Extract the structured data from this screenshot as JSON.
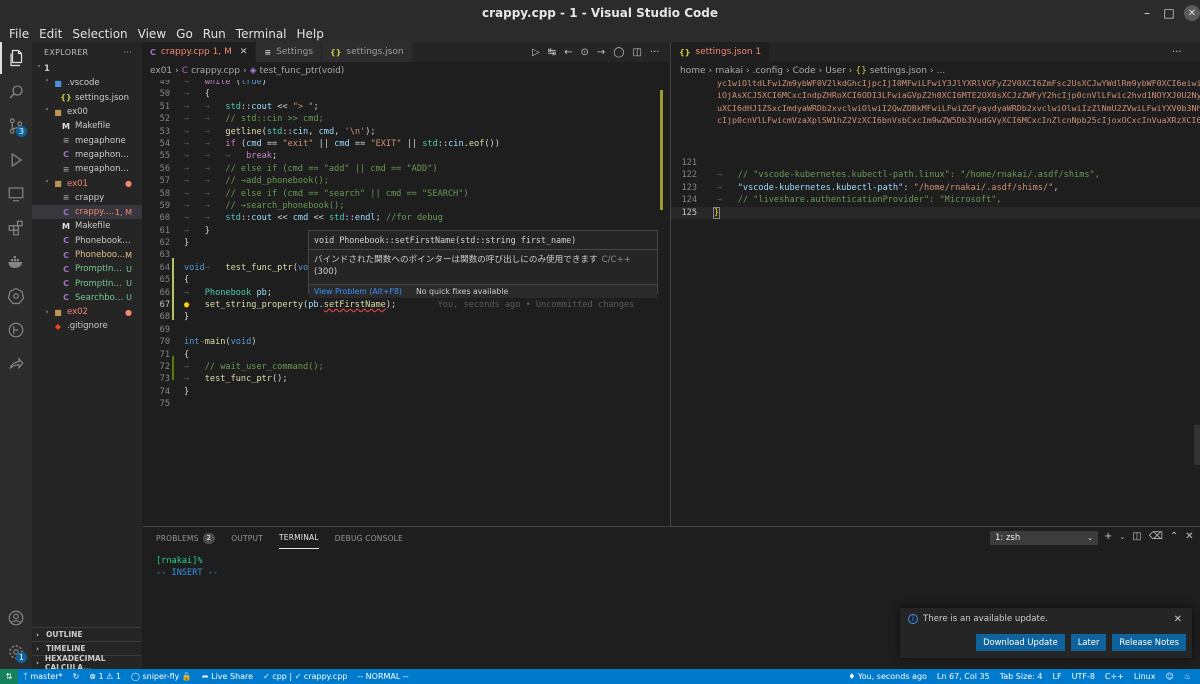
{
  "window": {
    "title": "crappy.cpp - 1 - Visual Studio Code"
  },
  "menu": [
    "File",
    "Edit",
    "Selection",
    "View",
    "Go",
    "Run",
    "Terminal",
    "Help"
  ],
  "activity": {
    "source_control_badge": "3",
    "settings_badge": "1"
  },
  "explorer": {
    "header": "EXPLORER",
    "more": "···",
    "root": "1",
    "items": [
      {
        "chev": "˅",
        "icon": "■",
        "icon_color": "#4a90d9",
        "name": ".vscode",
        "status": "",
        "cls": "",
        "depth": 1
      },
      {
        "chev": "",
        "icon": "{}",
        "icon_color": "#cbcb41",
        "name": "settings.json",
        "status": "",
        "cls": "",
        "depth": 2
      },
      {
        "chev": "˅",
        "icon": "■",
        "icon_color": "#c09553",
        "name": "ex00",
        "status": "",
        "cls": "",
        "depth": 1
      },
      {
        "chev": "",
        "icon": "M",
        "icon_color": "#e0e0e0",
        "name": "Makefile",
        "status": "",
        "cls": "",
        "depth": 2
      },
      {
        "chev": "",
        "icon": "≡",
        "icon_color": "#8c8c8c",
        "name": "megaphone",
        "status": "",
        "cls": "",
        "depth": 2
      },
      {
        "chev": "",
        "icon": "C",
        "icon_color": "#a074c4",
        "name": "megaphone.cpp",
        "status": "",
        "cls": "",
        "depth": 2
      },
      {
        "chev": "",
        "icon": "≡",
        "icon_color": "#8c8c8c",
        "name": "megaphone.o",
        "status": "",
        "cls": "",
        "depth": 2
      },
      {
        "chev": "˅",
        "icon": "■",
        "icon_color": "#c09553",
        "name": "ex01",
        "status": "●",
        "cls": "c-err",
        "depth": 1
      },
      {
        "chev": "",
        "icon": "≡",
        "icon_color": "#8c8c8c",
        "name": "crappy",
        "status": "",
        "cls": "",
        "depth": 2
      },
      {
        "chev": "",
        "icon": "C",
        "icon_color": "#a074c4",
        "name": "crappy.c...",
        "status": "1, M",
        "cls": "c-err",
        "depth": 2,
        "selected": true
      },
      {
        "chev": "",
        "icon": "M",
        "icon_color": "#e0e0e0",
        "name": "Makefile",
        "status": "",
        "cls": "",
        "depth": 2
      },
      {
        "chev": "",
        "icon": "C",
        "icon_color": "#a074c4",
        "name": "Phonebook.cpp",
        "status": "",
        "cls": "",
        "depth": 2
      },
      {
        "chev": "",
        "icon": "C",
        "icon_color": "#a074c4",
        "name": "Phoneboo...",
        "status": "M",
        "cls": "c-mod",
        "depth": 2
      },
      {
        "chev": "",
        "icon": "C",
        "icon_color": "#a074c4",
        "name": "PromptInp...",
        "status": "U",
        "cls": "c-untr",
        "depth": 2
      },
      {
        "chev": "",
        "icon": "C",
        "icon_color": "#a074c4",
        "name": "PromptInp...",
        "status": "U",
        "cls": "c-untr",
        "depth": 2
      },
      {
        "chev": "",
        "icon": "C",
        "icon_color": "#a074c4",
        "name": "Searchboo...",
        "status": "U",
        "cls": "c-untr",
        "depth": 2
      },
      {
        "chev": "›",
        "icon": "■",
        "icon_color": "#c09553",
        "name": "ex02",
        "status": "●",
        "cls": "c-err",
        "depth": 1
      },
      {
        "chev": "",
        "icon": "◆",
        "icon_color": "#e64a19",
        "name": ".gitignore",
        "status": "",
        "cls": "",
        "depth": 1
      }
    ],
    "bottom_sections": [
      "OUTLINE",
      "TIMELINE",
      "HEXADECIMAL CALCULA..."
    ]
  },
  "editor_left": {
    "tabs": [
      {
        "icon": "C",
        "label": "crappy.cpp",
        "status": "1, M",
        "active": true
      },
      {
        "icon": "≡",
        "label": "Settings",
        "status": "",
        "active": false
      },
      {
        "icon": "{}",
        "label": "settings.json",
        "status": "",
        "active": false
      }
    ],
    "breadcrumb": [
      "ex01",
      "crappy.cpp",
      "test_func_ptr(void)"
    ],
    "hover": {
      "signature": "void Phonebook::setFirstName(std::string first_name)",
      "message": "バインドされた関数へのポインターは関数の呼び出しにのみ使用できます",
      "source": "C/C++",
      "code": "(300)",
      "view_problem": "View Problem (Alt+F8)",
      "no_fixes": "No quick fixes available"
    },
    "blame": "You, seconds ago • Uncommitted changes"
  },
  "editor_right": {
    "tabs": [
      {
        "icon": "{}",
        "label": "settings.json",
        "status": "1",
        "active": true
      }
    ],
    "breadcrumb": [
      "home",
      "rnakai",
      ".config",
      "Code",
      "User",
      "settings.json",
      "..."
    ]
  },
  "panel": {
    "tabs": [
      {
        "label": "PROBLEMS",
        "badge": "2",
        "active": false
      },
      {
        "label": "OUTPUT",
        "badge": "",
        "active": false
      },
      {
        "label": "TERMINAL",
        "badge": "",
        "active": true
      },
      {
        "label": "DEBUG CONSOLE",
        "badge": "",
        "active": false
      }
    ],
    "terminal_select": "1: zsh",
    "terminal_lines": [
      "[rnakai]%",
      "-- INSERT --"
    ]
  },
  "notification": {
    "message": "There is an available update.",
    "buttons": [
      "Download Update",
      "Later",
      "Release Notes"
    ]
  },
  "statusbar": {
    "left": [
      "master*",
      "⊗ 1 ⚠ 1",
      "sniper-fly 🔒",
      "Live Share",
      "✓ cpp | ✓ crappy.cpp",
      "-- NORMAL --"
    ],
    "right": [
      "You, seconds ago",
      "Ln 67, Col 35",
      "Tab Size: 4",
      "LF",
      "UTF-8",
      "C++",
      "Linux"
    ]
  },
  "colors": {
    "accent": "#007acc",
    "remote": "#16825d",
    "error": "#f48771",
    "modified": "#e2c08d",
    "untracked": "#73c991"
  }
}
